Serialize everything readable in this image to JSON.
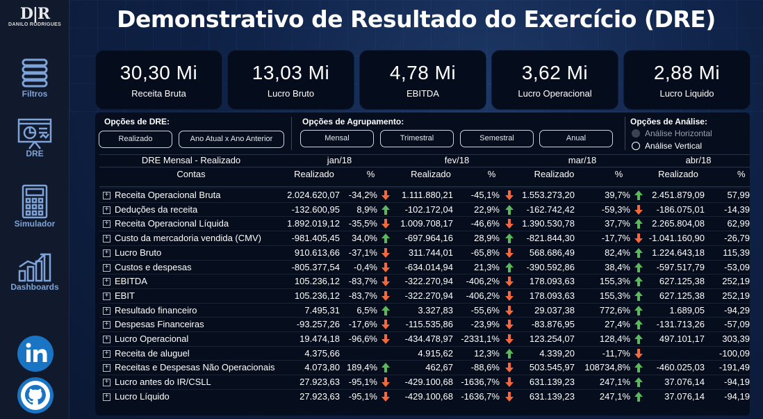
{
  "title": "Demonstrativo de Resultado do Exercício (DRE)",
  "logo": {
    "mark": "D|R",
    "text": "DANILO RODRIGUES"
  },
  "nav": [
    {
      "label": "Filtros",
      "icon": "filter-stack-icon"
    },
    {
      "label": "DRE",
      "icon": "presentation-chart-icon"
    },
    {
      "label": "Simulador",
      "icon": "calculator-icon"
    },
    {
      "label": "Dashboards",
      "icon": "bar-chart-icon"
    }
  ],
  "social": [
    {
      "name": "linkedin-icon"
    },
    {
      "name": "github-icon"
    }
  ],
  "kpis": [
    {
      "value": "30,30 Mi",
      "label": "Receita Bruta"
    },
    {
      "value": "13,03 Mi",
      "label": "Lucro Bruto"
    },
    {
      "value": "4,78 Mi",
      "label": "EBITDA"
    },
    {
      "value": "3,62 Mi",
      "label": "Lucro Operacional"
    },
    {
      "value": "2,88 Mi",
      "label": "Lucro Liquido"
    }
  ],
  "options": {
    "dre_title": "Opções de DRE:",
    "dre_buttons": [
      "Realizado",
      "Ano Atual x Ano Anterior"
    ],
    "group_title": "Opções de Agrupamento:",
    "group_buttons": [
      "Mensal",
      "Trimestral",
      "Semestral",
      "Anual"
    ],
    "analysis_title": "Opções de Análise:",
    "analysis_options": [
      "Análise Horizontal",
      "Análise Vertical"
    ]
  },
  "table": {
    "corner_title": "DRE Mensal - Realizado",
    "accounts_header": "Contas",
    "months": [
      "jan/18",
      "fev/18",
      "mar/18",
      "abr/18"
    ],
    "sub_headers": [
      "Realizado",
      "%"
    ],
    "rows": [
      {
        "conta": "Receita Operacional Bruta",
        "cells": [
          [
            "2.024.620,07",
            "-34,2%",
            "down"
          ],
          [
            "1.111.880,21",
            "-45,1%",
            "down"
          ],
          [
            "1.553.273,20",
            "39,7%",
            "up"
          ],
          [
            "2.451.879,09",
            "57,99",
            ""
          ]
        ]
      },
      {
        "conta": "Deduções da receita",
        "cells": [
          [
            "-132.600,95",
            "8,9%",
            "up"
          ],
          [
            "-102.172,04",
            "22,9%",
            "up"
          ],
          [
            "-162.742,42",
            "-59,3%",
            "down"
          ],
          [
            "-186.075,01",
            "-14,39",
            ""
          ]
        ]
      },
      {
        "conta": "Receita Operacional Líquida",
        "cells": [
          [
            "1.892.019,12",
            "-35,5%",
            "down"
          ],
          [
            "1.009.708,17",
            "-46,6%",
            "down"
          ],
          [
            "1.390.530,78",
            "37,7%",
            "up"
          ],
          [
            "2.265.804,08",
            "62,99",
            ""
          ]
        ]
      },
      {
        "conta": "Custo da mercadoria vendida (CMV)",
        "cells": [
          [
            "-981.405,45",
            "34,0%",
            "up"
          ],
          [
            "-697.964,16",
            "28,9%",
            "up"
          ],
          [
            "-821.844,30",
            "-17,7%",
            "down"
          ],
          [
            "-1.041.160,90",
            "-26,79",
            ""
          ]
        ]
      },
      {
        "conta": "Lucro Bruto",
        "cells": [
          [
            "910.613,66",
            "-37,1%",
            "down"
          ],
          [
            "311.744,01",
            "-65,8%",
            "down"
          ],
          [
            "568.686,49",
            "82,4%",
            "up"
          ],
          [
            "1.224.643,18",
            "115,39",
            ""
          ]
        ]
      },
      {
        "conta": "Custos e despesas",
        "cells": [
          [
            "-805.377,54",
            "-0,4%",
            "down"
          ],
          [
            "-634.014,94",
            "21,3%",
            "up"
          ],
          [
            "-390.592,86",
            "38,4%",
            "up"
          ],
          [
            "-597.517,79",
            "-53,09",
            ""
          ]
        ]
      },
      {
        "conta": "EBITDA",
        "cells": [
          [
            "105.236,12",
            "-83,7%",
            "down"
          ],
          [
            "-322.270,94",
            "-406,2%",
            "down"
          ],
          [
            "178.093,63",
            "155,3%",
            "up"
          ],
          [
            "627.125,38",
            "252,19",
            ""
          ]
        ]
      },
      {
        "conta": "EBIT",
        "cells": [
          [
            "105.236,12",
            "-83,7%",
            "down"
          ],
          [
            "-322.270,94",
            "-406,2%",
            "down"
          ],
          [
            "178.093,63",
            "155,3%",
            "up"
          ],
          [
            "627.125,38",
            "252,19",
            ""
          ]
        ]
      },
      {
        "conta": "Resultado financeiro",
        "cells": [
          [
            "7.495,31",
            "6,5%",
            "up"
          ],
          [
            "3.327,83",
            "-55,6%",
            "down"
          ],
          [
            "29.037,38",
            "772,6%",
            "up"
          ],
          [
            "1.689,05",
            "-94,29",
            ""
          ]
        ]
      },
      {
        "conta": "Despesas Financeiras",
        "cells": [
          [
            "-93.257,26",
            "-17,6%",
            "down"
          ],
          [
            "-115.535,86",
            "-23,9%",
            "down"
          ],
          [
            "-83.876,95",
            "27,4%",
            "up"
          ],
          [
            "-131.713,26",
            "-57,09",
            ""
          ]
        ]
      },
      {
        "conta": "Lucro Operacional",
        "cells": [
          [
            "19.474,18",
            "-96,6%",
            "down"
          ],
          [
            "-434.478,97",
            "-2331,1%",
            "down"
          ],
          [
            "123.254,07",
            "128,4%",
            "up"
          ],
          [
            "497.101,17",
            "303,39",
            ""
          ]
        ]
      },
      {
        "conta": "Receita de aluguel",
        "cells": [
          [
            "4.375,66",
            "",
            ""
          ],
          [
            "4.915,62",
            "12,3%",
            "up"
          ],
          [
            "4.339,20",
            "-11,7%",
            "down"
          ],
          [
            "",
            "-100,09",
            ""
          ]
        ]
      },
      {
        "conta": "Receitas e Despesas Não Operacionais",
        "cells": [
          [
            "4.073,80",
            "189,4%",
            "up"
          ],
          [
            "462,67",
            "-88,6%",
            "down"
          ],
          [
            "503.545,97",
            "108734,8%",
            "up"
          ],
          [
            "-460.025,03",
            "-191,49",
            ""
          ]
        ]
      },
      {
        "conta": "Lucro antes do IR/CSLL",
        "cells": [
          [
            "27.923,63",
            "-95,1%",
            "down"
          ],
          [
            "-429.100,68",
            "-1636,7%",
            "down"
          ],
          [
            "631.139,23",
            "247,1%",
            "up"
          ],
          [
            "37.076,14",
            "-94,19",
            ""
          ]
        ]
      },
      {
        "conta": "Lucro Líquido",
        "cells": [
          [
            "27.923,63",
            "-95,1%",
            "down"
          ],
          [
            "-429.100,68",
            "-1636,7%",
            "down"
          ],
          [
            "631.139,23",
            "247,1%",
            "up"
          ],
          [
            "37.076,14",
            "-94,19",
            ""
          ]
        ]
      }
    ]
  },
  "colors": {
    "up": "#5cb85c",
    "down": "#f4683c"
  }
}
